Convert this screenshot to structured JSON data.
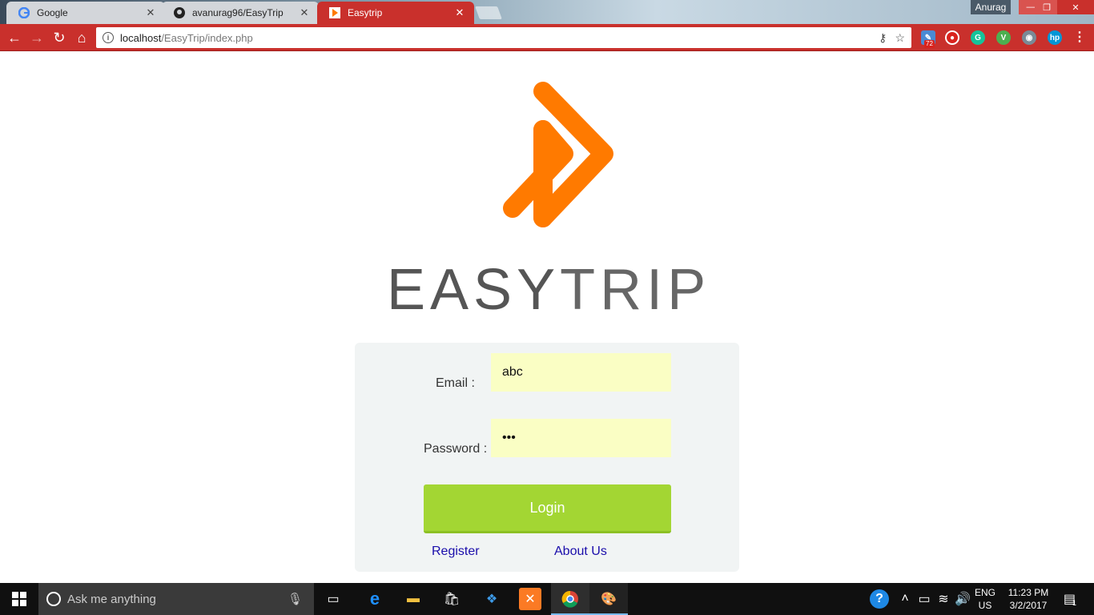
{
  "browser": {
    "tabs": [
      {
        "title": "Google",
        "close": "✕"
      },
      {
        "title": "avanurag96/EasyTrip",
        "close": "✕"
      },
      {
        "title": "Easytrip",
        "close": "✕"
      }
    ],
    "profile_name": "Anurag",
    "window_controls": {
      "minimize": "—",
      "restore": "❐",
      "close": "✕"
    },
    "url_host": "localhost",
    "url_path": "/EasyTrip/index.php",
    "extension_badge": "72"
  },
  "page": {
    "brand_easy": "EASY",
    "brand_trip": "TRIP",
    "brand_color": "#ff7a00",
    "login": {
      "email_label": "Email :",
      "email_value": "abc",
      "password_label": "Password :",
      "password_value": "•••",
      "button_label": "Login",
      "register_link": "Register",
      "about_link": "About Us"
    }
  },
  "taskbar": {
    "search_placeholder": "Ask me anything",
    "lang_line1": "ENG",
    "lang_line2": "US",
    "time": "11:23 PM",
    "date": "3/2/2017",
    "notification_count": "1"
  }
}
